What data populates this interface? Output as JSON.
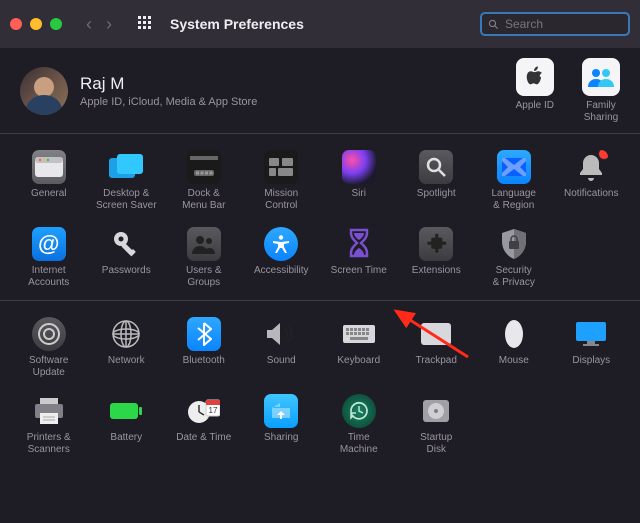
{
  "window": {
    "title": "System Preferences",
    "search_placeholder": "Search"
  },
  "profile": {
    "name": "Raj M",
    "subtitle": "Apple ID, iCloud, Media & App Store",
    "shortcuts": {
      "apple_id": "Apple ID",
      "family": "Family\nSharing"
    }
  },
  "rows": [
    [
      {
        "id": "general",
        "label": "General"
      },
      {
        "id": "desktop",
        "label": "Desktop &\nScreen Saver"
      },
      {
        "id": "dock",
        "label": "Dock &\nMenu Bar"
      },
      {
        "id": "mission",
        "label": "Mission\nControl"
      },
      {
        "id": "siri",
        "label": "Siri"
      },
      {
        "id": "spotlight",
        "label": "Spotlight"
      },
      {
        "id": "language",
        "label": "Language\n& Region"
      },
      {
        "id": "notifications",
        "label": "Notifications"
      }
    ],
    [
      {
        "id": "internet",
        "label": "Internet\nAccounts"
      },
      {
        "id": "passwords",
        "label": "Passwords"
      },
      {
        "id": "users",
        "label": "Users &\nGroups"
      },
      {
        "id": "accessibility",
        "label": "Accessibility"
      },
      {
        "id": "screentime",
        "label": "Screen Time"
      },
      {
        "id": "extensions",
        "label": "Extensions"
      },
      {
        "id": "security",
        "label": "Security\n& Privacy"
      },
      {
        "id": "empty1",
        "label": ""
      }
    ],
    [
      {
        "id": "update",
        "label": "Software\nUpdate"
      },
      {
        "id": "network",
        "label": "Network"
      },
      {
        "id": "bluetooth",
        "label": "Bluetooth"
      },
      {
        "id": "sound",
        "label": "Sound"
      },
      {
        "id": "keyboard",
        "label": "Keyboard"
      },
      {
        "id": "trackpad",
        "label": "Trackpad"
      },
      {
        "id": "mouse",
        "label": "Mouse"
      },
      {
        "id": "displays",
        "label": "Displays"
      }
    ],
    [
      {
        "id": "printers",
        "label": "Printers &\nScanners"
      },
      {
        "id": "battery",
        "label": "Battery"
      },
      {
        "id": "datetime",
        "label": "Date & Time"
      },
      {
        "id": "sharing",
        "label": "Sharing"
      },
      {
        "id": "timemachine",
        "label": "Time\nMachine"
      },
      {
        "id": "startup",
        "label": "Startup\nDisk"
      },
      {
        "id": "empty2",
        "label": ""
      },
      {
        "id": "empty3",
        "label": ""
      }
    ]
  ]
}
